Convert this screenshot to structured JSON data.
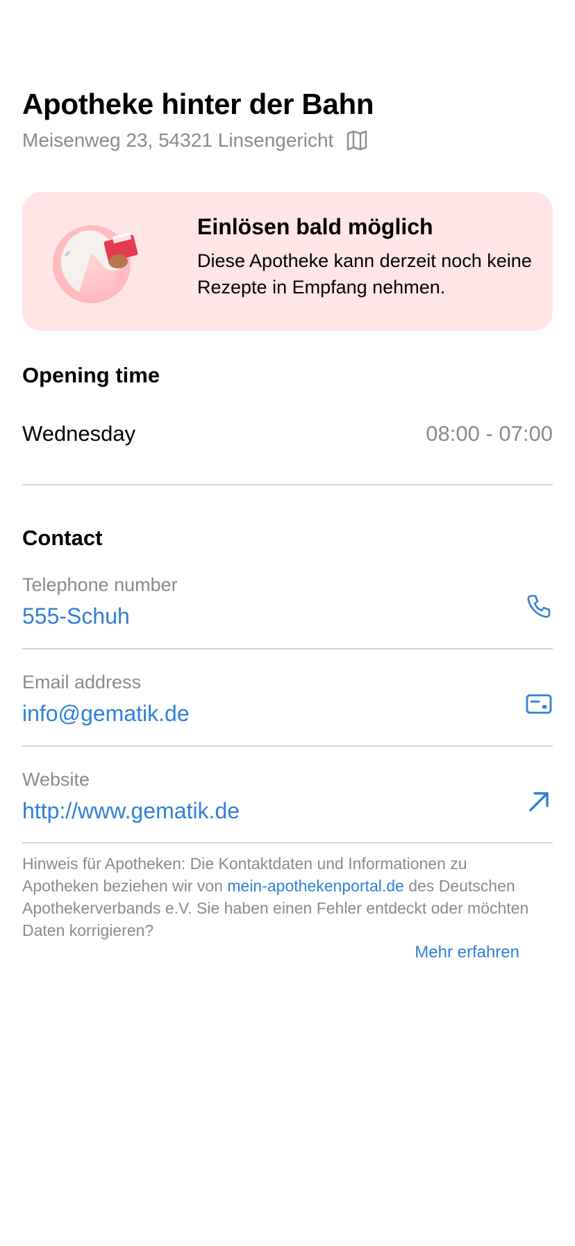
{
  "pharmacy": {
    "name": "Apotheke hinter der Bahn",
    "address": "Meisenweg 23, 54321 Linsengericht",
    "map_icon": "map-icon"
  },
  "banner": {
    "title": "Einlösen bald möglich",
    "text": "Diese Apotheke kann derzeit noch keine Rezepte in Empfang nehmen.",
    "background_color": "#ffe5e6"
  },
  "opening": {
    "heading": "Opening time",
    "day": "Wednesday",
    "hours": "08:00 - 07:00"
  },
  "contact": {
    "heading": "Contact",
    "items": [
      {
        "label": "Telephone number",
        "value": "555-Schuh",
        "icon": "phone-icon"
      },
      {
        "label": "Email address",
        "value": "info@gematik.de",
        "icon": "mail-card-icon"
      },
      {
        "label": "Website",
        "value": "http://www.gematik.de",
        "icon": "external-arrow-icon"
      }
    ]
  },
  "footnote": {
    "text_before": "Hinweis für Apotheken: Die Kontaktdaten und Informationen zu Apotheken beziehen wir von ",
    "link": "mein-apothekenportal.de",
    "text_after": " des Deutschen Apothekerverbands e.V. Sie haben einen Fehler entdeckt oder möchten Daten korrigieren?",
    "more": "Mehr erfahren"
  },
  "colors": {
    "accent": "#2f80d6",
    "secondary_text": "#8a8a8e"
  }
}
